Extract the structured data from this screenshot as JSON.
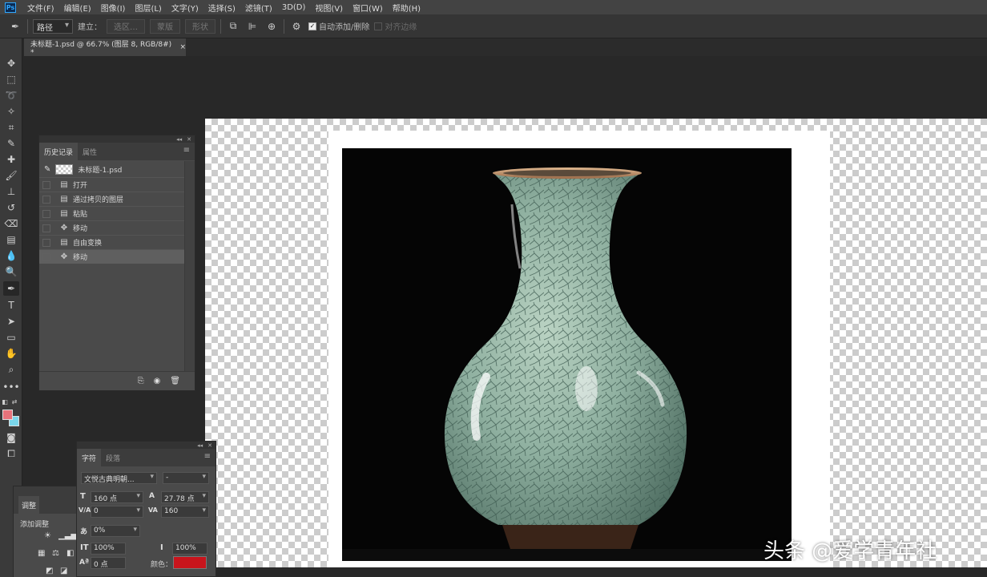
{
  "app": {
    "logo": "Ps"
  },
  "menu": [
    "文件(F)",
    "编辑(E)",
    "图像(I)",
    "图层(L)",
    "文字(Y)",
    "选择(S)",
    "滤镜(T)",
    "3D(D)",
    "视图(V)",
    "窗口(W)",
    "帮助(H)"
  ],
  "options": {
    "tool_mode": "路径",
    "build_label": "建立：",
    "selection_btn": "选区…",
    "mask_btn": "蒙版",
    "shape_btn": "形状",
    "auto_add_delete_label": "自动添加/删除",
    "auto_add_delete_checked": true,
    "align_edges_label": "对齐边缘",
    "align_edges_checked": false
  },
  "document_tab": {
    "title": "未标题-1.psd @ 66.7% (图层 8, RGB/8#) *",
    "close": "×"
  },
  "history_panel": {
    "tabs": [
      "历史记录",
      "属性"
    ],
    "snapshot": "未标题-1.psd",
    "steps": [
      {
        "label": "打开",
        "icon": "document-icon"
      },
      {
        "label": "通过拷贝的图层",
        "icon": "document-icon"
      },
      {
        "label": "粘贴",
        "icon": "document-icon"
      },
      {
        "label": "移动",
        "icon": "move-icon"
      },
      {
        "label": "自由变换",
        "icon": "document-icon"
      },
      {
        "label": "移动",
        "icon": "move-icon",
        "selected": true
      }
    ]
  },
  "adjustments_panel": {
    "tab": "调整",
    "title": "添加调整"
  },
  "character_panel": {
    "tabs": [
      "字符",
      "段落"
    ],
    "font_family": "文悦古典明朝...",
    "font_style": "-",
    "font_size": "160 点",
    "leading": "27.78 点",
    "kerning": "0",
    "tracking": "160",
    "tsume": "0%",
    "vertical_scale": "100%",
    "horizontal_scale": "100%",
    "baseline_shift": "0 点",
    "color_label": "颜色：",
    "color_value": "#c8141c"
  },
  "colors": {
    "foreground": "#e8727a",
    "background": "#7ad6ea"
  },
  "watermark": "头条 @爱学青年社"
}
